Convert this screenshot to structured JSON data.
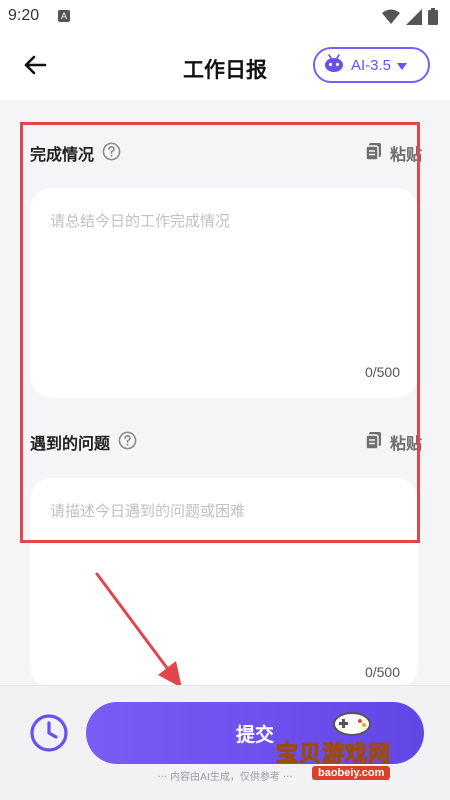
{
  "status_bar": {
    "time": "9:20",
    "app_icon": "A",
    "icons": [
      "wifi-icon",
      "signal-icon",
      "battery-icon"
    ]
  },
  "header": {
    "back_icon": "arrow-left-icon",
    "title": "工作日报",
    "model_selector": {
      "label": "AI-3.5",
      "icon": "robot-icon",
      "dropdown_icon": "triangle-down-icon"
    }
  },
  "sections": [
    {
      "title": "完成情况",
      "help_icon": "question-circle-icon",
      "paste_label": "粘贴",
      "paste_icon": "clipboard-icon",
      "placeholder": "请总结今日的工作完成情况",
      "value": "",
      "counter": "0/500"
    },
    {
      "title": "遇到的问题",
      "help_icon": "question-circle-icon",
      "paste_label": "粘贴",
      "paste_icon": "clipboard-icon",
      "placeholder": "请描述今日遇到的问题或困难",
      "value": "",
      "counter": "0/500"
    }
  ],
  "bottom": {
    "history_icon": "clock-icon",
    "submit_label": "提交",
    "disclaimer": "··· 内容由AI生成，仅供参考 ···"
  },
  "watermark": {
    "title": "宝贝游戏网",
    "site": "baobeiy.com"
  },
  "colors": {
    "accent": "#7a5cf6",
    "highlight": "#e0474c",
    "background": "#f5f5f7"
  }
}
